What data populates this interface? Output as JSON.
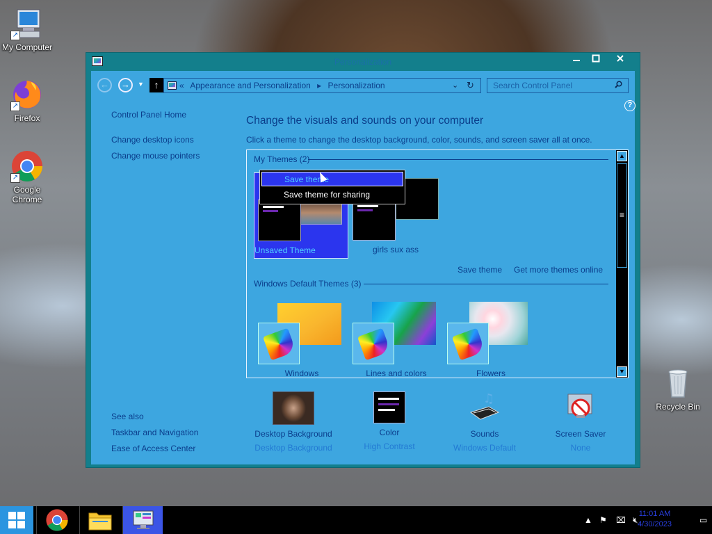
{
  "desktop": {
    "icons": [
      {
        "label": "My Computer"
      },
      {
        "label": "Firefox"
      },
      {
        "label": "Google Chrome"
      },
      {
        "label": "Recycle Bin"
      }
    ]
  },
  "window": {
    "title": "Personalization",
    "breadcrumb": {
      "prefix": "«",
      "items": [
        "Appearance and Personalization",
        "Personalization"
      ],
      "separator": "▸"
    },
    "search_placeholder": "Search Control Panel",
    "left_nav": {
      "home": "Control Panel Home",
      "links": [
        "Change desktop icons",
        "Change mouse pointers"
      ],
      "see_also_title": "See also",
      "see_also": [
        "Taskbar and Navigation",
        "Ease of Access Center"
      ]
    },
    "heading": "Change the visuals and sounds on your computer",
    "subtext": "Click a theme to change the desktop background, color, sounds, and screen saver all at once.",
    "my_themes": {
      "title": "My Themes (2)",
      "items": [
        {
          "name": "Unsaved Theme",
          "selected": true
        },
        {
          "name": "girls sux ass",
          "selected": false
        }
      ],
      "save_link": "Save theme",
      "more_link": "Get more themes online"
    },
    "default_themes": {
      "title": "Windows Default Themes (3)",
      "items": [
        {
          "name": "Windows"
        },
        {
          "name": "Lines and colors"
        },
        {
          "name": "Flowers"
        }
      ]
    },
    "context_menu": {
      "items": [
        "Save theme",
        "Save theme for sharing"
      ],
      "highlighted_index": 0
    },
    "bottom": [
      {
        "title": "Desktop Background",
        "value": "Desktop Background"
      },
      {
        "title": "Color",
        "value": "High Contrast"
      },
      {
        "title": "Sounds",
        "value": "Windows Default"
      },
      {
        "title": "Screen Saver",
        "value": "None"
      }
    ]
  },
  "taskbar": {
    "time": "11:01 AM",
    "date": "4/30/2023"
  },
  "colors": {
    "window_frame": "#137f8c",
    "client_bg": "#3da6e0",
    "selection": "#2b35ee",
    "link_text": "#0b3e8c"
  }
}
